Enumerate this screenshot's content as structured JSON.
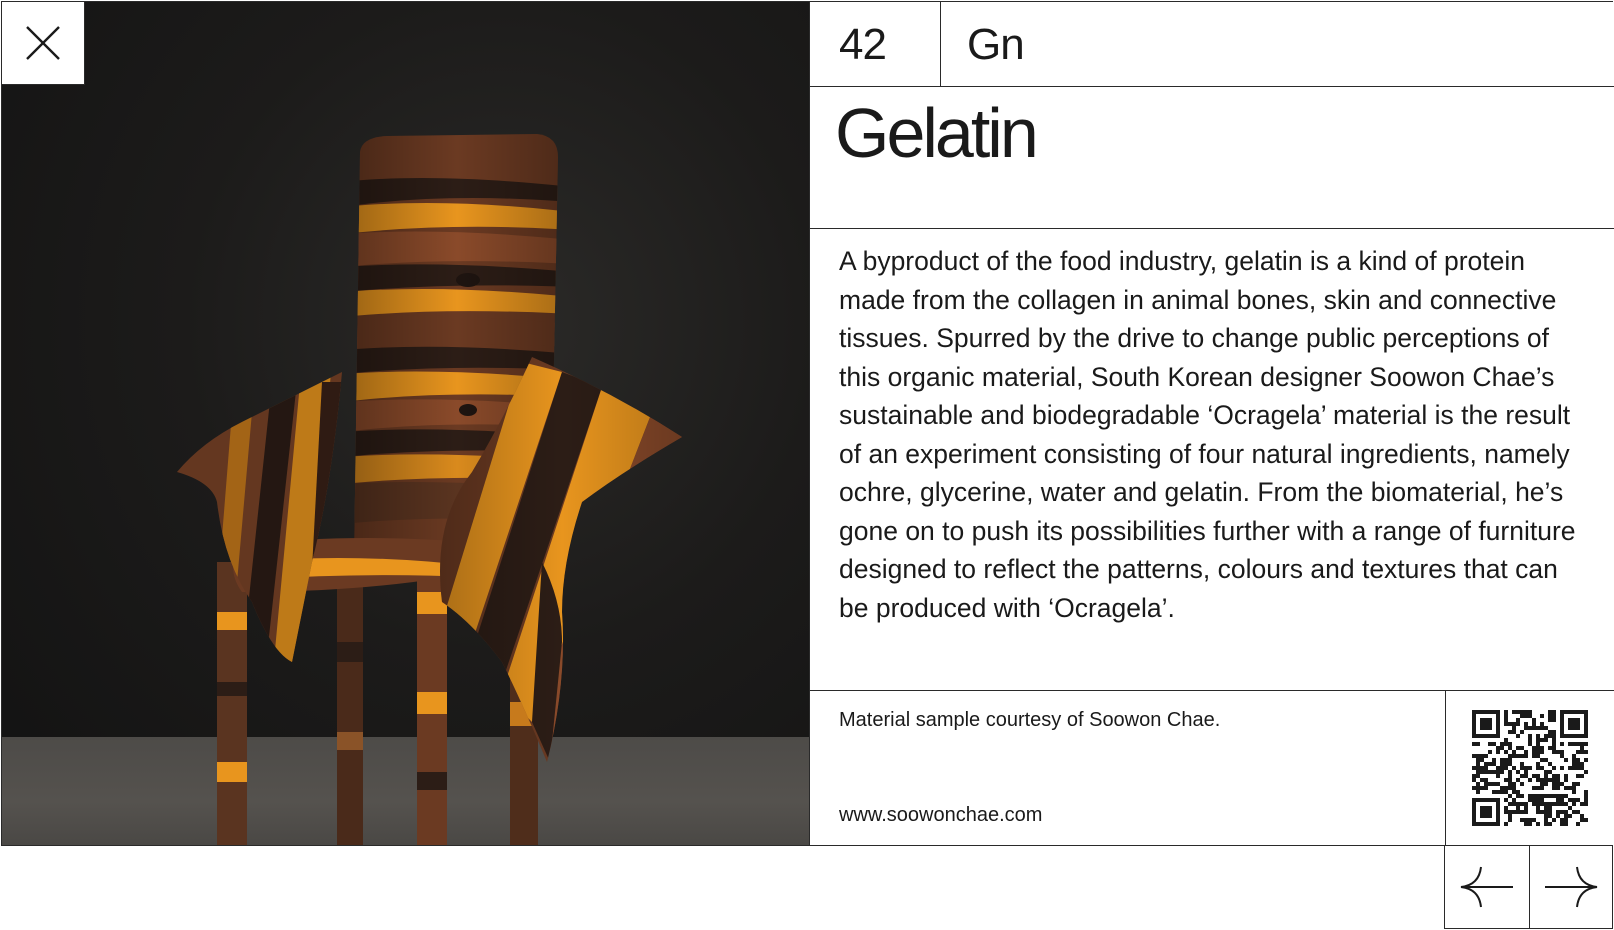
{
  "element": {
    "atomic_number": "42",
    "symbol": "Gn",
    "name": "Gelatin"
  },
  "description": "A byproduct of the food industry, gelatin is a kind of protein made from the collagen in animal bones, skin and connective tissues. Spurred by the drive to change public perceptions of this organic material, South Korean designer Soowon Chae’s sustainable and biodegradable ‘Ocragela’ material is the result of an experiment consisting of four natural ingredients, namely ochre, glycerine, water and gelatin. From the biomaterial, he’s gone on to push its possibilities further with a range of furniture designed to reflect the patterns, colours and textures that can be produced with ‘Ocragela’.",
  "footer": {
    "credit": "Material sample courtesy of Soowon Chae.",
    "website": "www.soowonchae.com"
  },
  "icons": {
    "close": "close-icon",
    "prev": "arrow-left-icon",
    "next": "arrow-right-icon",
    "qr": "qr-code-icon"
  },
  "colors": {
    "ochre": "#e8951e",
    "brown": "#6b3a22",
    "dark_brown": "#2c1d16",
    "background": "#ffffff",
    "line": "#2a2a2a"
  }
}
